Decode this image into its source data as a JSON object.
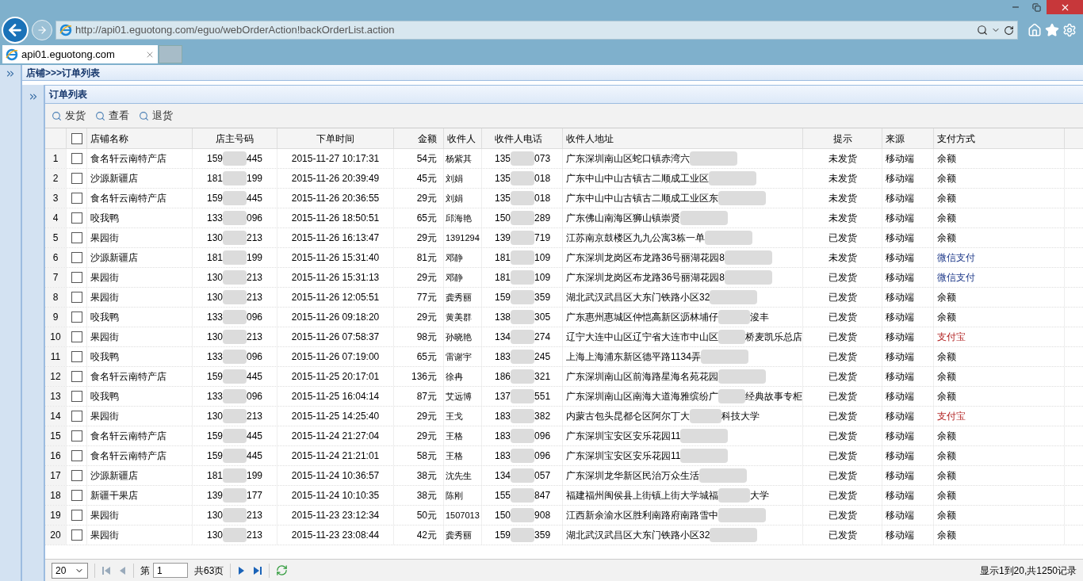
{
  "browser": {
    "url": "http://api01.eguotong.com/eguo/webOrderAction!backOrderList.action",
    "tab": "api01.eguotong.com"
  },
  "breadcrumb": "店铺>>>订单列表",
  "panel_title": "订单列表",
  "toolbar": [
    "发货",
    "查看",
    "退货"
  ],
  "header_checked": false,
  "columns": [
    "店铺名称",
    "店主号码",
    "下单时间",
    "金额",
    "收件人",
    "收件人电话",
    "收件人地址",
    "提示",
    "来源",
    "支付方式"
  ],
  "rows": [
    {
      "n": "1",
      "checked": false,
      "shop": "食名轩云南特产店",
      "owner": [
        "159",
        "445"
      ],
      "time": "2015-11-27 10:17:31",
      "amount": "54元",
      "receiver": "杨紫其",
      "phone": [
        "135",
        "073"
      ],
      "address": "广东深圳南山区蛇口镇赤湾六",
      "status": "未发货",
      "source": "移动端",
      "pay": {
        "text": "余额",
        "kind": "balance"
      }
    },
    {
      "n": "2",
      "checked": false,
      "shop": "沙源新疆店",
      "owner": [
        "181",
        "199"
      ],
      "time": "2015-11-26 20:39:49",
      "amount": "45元",
      "receiver": "刘娟",
      "phone": [
        "135",
        "018"
      ],
      "address": "广东中山中山古镇古二顺成工业区",
      "status": "未发货",
      "source": "移动端",
      "pay": {
        "text": "余额",
        "kind": "balance"
      }
    },
    {
      "n": "3",
      "checked": false,
      "shop": "食名轩云南特产店",
      "owner": [
        "159",
        "445"
      ],
      "time": "2015-11-26 20:36:55",
      "amount": "29元",
      "receiver": "刘娟",
      "phone": [
        "135",
        "018"
      ],
      "address": "广东中山中山古镇古二顺成工业区东",
      "status": "未发货",
      "source": "移动端",
      "pay": {
        "text": "余额",
        "kind": "balance"
      }
    },
    {
      "n": "4",
      "checked": false,
      "shop": "咬我鸭",
      "owner": [
        "133",
        "096"
      ],
      "time": "2015-11-26 18:50:51",
      "amount": "65元",
      "receiver": "邱海艳",
      "phone": [
        "150",
        "289"
      ],
      "address": "广东佛山南海区狮山镇崇贤",
      "status": "未发货",
      "source": "移动端",
      "pay": {
        "text": "余额",
        "kind": "balance"
      }
    },
    {
      "n": "5",
      "checked": false,
      "shop": "果园街",
      "owner": [
        "130",
        "213"
      ],
      "time": "2015-11-26 16:13:47",
      "amount": "29元",
      "receiver": "1391294",
      "phone": [
        "139",
        "719"
      ],
      "address": "江苏南京鼓楼区九九公寓3栋一单",
      "status": "已发货",
      "source": "移动端",
      "pay": {
        "text": "余额",
        "kind": "balance"
      }
    },
    {
      "n": "6",
      "checked": false,
      "shop": "沙源新疆店",
      "owner": [
        "181",
        "199"
      ],
      "time": "2015-11-26 15:31:40",
      "amount": "81元",
      "receiver": "邓静",
      "phone": [
        "181",
        "109"
      ],
      "address": "广东深圳龙岗区布龙路36号丽湖花园8",
      "status": "未发货",
      "source": "移动端",
      "pay": {
        "text": "微信支付",
        "kind": "wechat"
      }
    },
    {
      "n": "7",
      "checked": false,
      "shop": "果园街",
      "owner": [
        "130",
        "213"
      ],
      "time": "2015-11-26 15:31:13",
      "amount": "29元",
      "receiver": "邓静",
      "phone": [
        "181",
        "109"
      ],
      "address": "广东深圳龙岗区布龙路36号丽湖花园8",
      "status": "已发货",
      "source": "移动端",
      "pay": {
        "text": "微信支付",
        "kind": "wechat"
      }
    },
    {
      "n": "8",
      "checked": false,
      "shop": "果园街",
      "owner": [
        "130",
        "213"
      ],
      "time": "2015-11-26 12:05:51",
      "amount": "77元",
      "receiver": "龚秀丽",
      "phone": [
        "159",
        "359"
      ],
      "address": "湖北武汉武昌区大东门铁路小区32",
      "status": "已发货",
      "source": "移动端",
      "pay": {
        "text": "余额",
        "kind": "balance"
      }
    },
    {
      "n": "9",
      "checked": false,
      "shop": "咬我鸭",
      "owner": [
        "133",
        "096"
      ],
      "time": "2015-11-26 09:18:20",
      "amount": "29元",
      "receiver": "黄美群",
      "phone": [
        "138",
        "305"
      ],
      "address": "广东惠州惠城区仲恺高新区沥林埔仔",
      "address_end": "浚丰",
      "status": "已发货",
      "source": "移动端",
      "pay": {
        "text": "余额",
        "kind": "balance"
      }
    },
    {
      "n": "10",
      "checked": false,
      "shop": "果园街",
      "owner": [
        "130",
        "213"
      ],
      "time": "2015-11-26 07:58:37",
      "amount": "98元",
      "receiver": "孙晓艳",
      "phone": [
        "134",
        "274"
      ],
      "address": "辽宁大连中山区辽宁省大连市中山区",
      "address_end": "桥麦凯乐总店",
      "status": "已发货",
      "source": "移动端",
      "pay": {
        "text": "支付宝",
        "kind": "alipay"
      }
    },
    {
      "n": "11",
      "checked": false,
      "shop": "咬我鸭",
      "owner": [
        "133",
        "096"
      ],
      "time": "2015-11-26 07:19:00",
      "amount": "65元",
      "receiver": "雷谢宇",
      "phone": [
        "183",
        "245"
      ],
      "address": "上海上海浦东新区德平路1134弄",
      "status": "已发货",
      "source": "移动端",
      "pay": {
        "text": "余额",
        "kind": "balance"
      }
    },
    {
      "n": "12",
      "checked": false,
      "shop": "食名轩云南特产店",
      "owner": [
        "159",
        "445"
      ],
      "time": "2015-11-25 20:17:01",
      "amount": "136元",
      "receiver": "徐冉",
      "phone": [
        "186",
        "321"
      ],
      "address": "广东深圳南山区前海路星海名苑花园",
      "status": "已发货",
      "source": "移动端",
      "pay": {
        "text": "余额",
        "kind": "balance"
      }
    },
    {
      "n": "13",
      "checked": false,
      "shop": "咬我鸭",
      "owner": [
        "133",
        "096"
      ],
      "time": "2015-11-25 16:04:14",
      "amount": "87元",
      "receiver": "艾远博",
      "phone": [
        "137",
        "551"
      ],
      "address": "广东深圳南山区南海大道海雅缤纷广",
      "address_end": "经典故事专柜",
      "status": "已发货",
      "source": "移动端",
      "pay": {
        "text": "余额",
        "kind": "balance"
      }
    },
    {
      "n": "14",
      "checked": false,
      "shop": "果园街",
      "owner": [
        "130",
        "213"
      ],
      "time": "2015-11-25 14:25:40",
      "amount": "29元",
      "receiver": "王戈",
      "phone": [
        "183",
        "382"
      ],
      "address": "内蒙古包头昆都仑区阿尔丁大",
      "address_end": "科技大学",
      "status": "已发货",
      "source": "移动端",
      "pay": {
        "text": "支付宝",
        "kind": "alipay"
      }
    },
    {
      "n": "15",
      "checked": false,
      "shop": "食名轩云南特产店",
      "owner": [
        "159",
        "445"
      ],
      "time": "2015-11-24 21:27:04",
      "amount": "29元",
      "receiver": "王格",
      "phone": [
        "183",
        "096"
      ],
      "address": "广东深圳宝安区安乐花园11",
      "status": "已发货",
      "source": "移动端",
      "pay": {
        "text": "余额",
        "kind": "balance"
      }
    },
    {
      "n": "16",
      "checked": false,
      "shop": "食名轩云南特产店",
      "owner": [
        "159",
        "445"
      ],
      "time": "2015-11-24 21:21:01",
      "amount": "58元",
      "receiver": "王格",
      "phone": [
        "183",
        "096"
      ],
      "address": "广东深圳宝安区安乐花园11",
      "status": "已发货",
      "source": "移动端",
      "pay": {
        "text": "余额",
        "kind": "balance"
      }
    },
    {
      "n": "17",
      "checked": false,
      "shop": "沙源新疆店",
      "owner": [
        "181",
        "199"
      ],
      "time": "2015-11-24 10:36:57",
      "amount": "38元",
      "receiver": "沈先生",
      "phone": [
        "134",
        "057"
      ],
      "address": "广东深圳龙华新区民治万众生活",
      "status": "已发货",
      "source": "移动端",
      "pay": {
        "text": "余额",
        "kind": "balance"
      }
    },
    {
      "n": "18",
      "checked": false,
      "shop": "新疆干果店",
      "owner": [
        "139",
        "177"
      ],
      "time": "2015-11-24 10:10:35",
      "amount": "38元",
      "receiver": "陈刚",
      "phone": [
        "155",
        "847"
      ],
      "address": "福建福州闽侯县上街镇上街大学城福",
      "address_end": "大学",
      "status": "已发货",
      "source": "移动端",
      "pay": {
        "text": "余额",
        "kind": "balance"
      }
    },
    {
      "n": "19",
      "checked": false,
      "shop": "果园街",
      "owner": [
        "130",
        "213"
      ],
      "time": "2015-11-23 23:12:34",
      "amount": "50元",
      "receiver": "1507013",
      "phone": [
        "150",
        "908"
      ],
      "address": "江西新余渝水区胜利南路府南路雪中",
      "status": "已发货",
      "source": "移动端",
      "pay": {
        "text": "余额",
        "kind": "balance"
      }
    },
    {
      "n": "20",
      "checked": false,
      "shop": "果园街",
      "owner": [
        "130",
        "213"
      ],
      "time": "2015-11-23 23:08:44",
      "amount": "42元",
      "receiver": "龚秀丽",
      "phone": [
        "159",
        "359"
      ],
      "address": "湖北武汉武昌区大东门铁路小区32",
      "status": "已发货",
      "source": "移动端",
      "pay": {
        "text": "余额",
        "kind": "balance"
      }
    }
  ],
  "pager": {
    "page_size": "20",
    "page_label": "第",
    "page": "1",
    "total_pages": "共63页",
    "summary": "显示1到20,共1250记录"
  }
}
